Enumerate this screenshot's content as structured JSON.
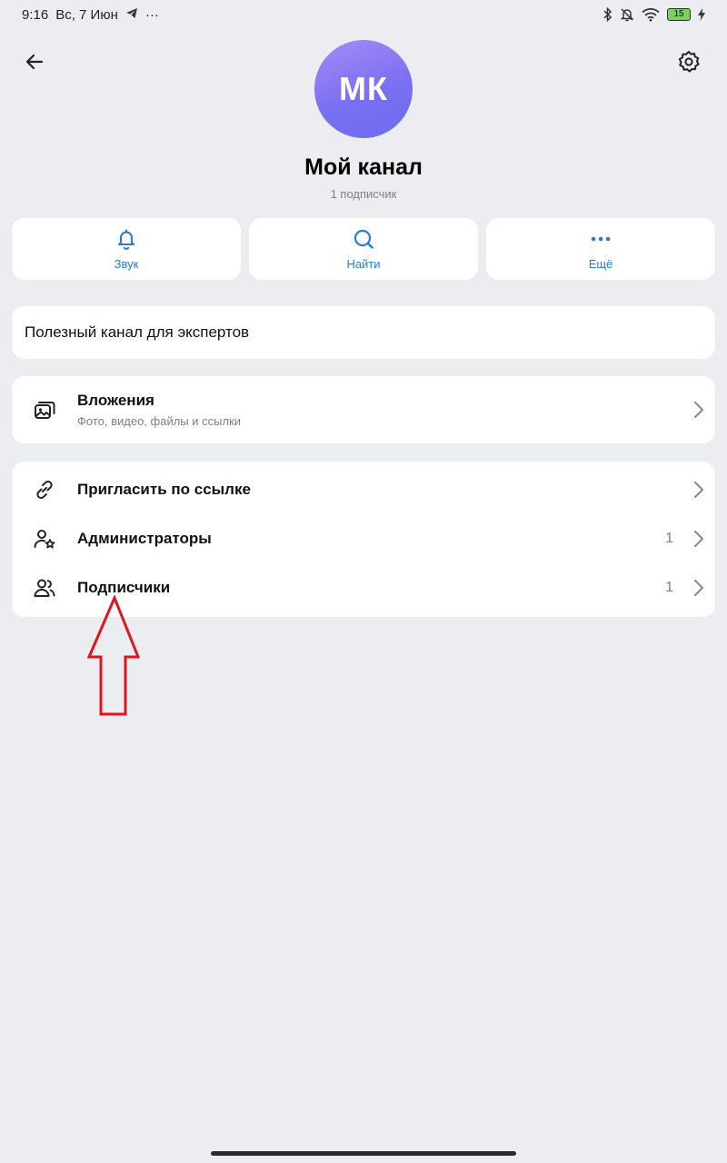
{
  "status_bar": {
    "time": "9:16",
    "date": "Вс, 7 Июн",
    "more": "···",
    "battery": "15",
    "icons": [
      "telegram-icon",
      "bluetooth-icon",
      "mute-bell-icon",
      "wifi-icon",
      "battery-icon",
      "charging-icon"
    ]
  },
  "header": {
    "back_icon": "arrow-left-icon",
    "settings_icon": "gear-icon",
    "avatar_initials": "МК",
    "title": "Мой канал",
    "subtitle": "1 подписчик"
  },
  "actions": [
    {
      "label": "Звук",
      "icon": "bell-icon"
    },
    {
      "label": "Найти",
      "icon": "search-icon"
    },
    {
      "label": "Ещё",
      "icon": "more-dots-icon"
    }
  ],
  "description": "Полезный канал для экспертов",
  "attachments": {
    "title": "Вложения",
    "subtitle": "Фото, видео, файлы и ссылки"
  },
  "links": [
    {
      "label": "Пригласить по ссылке",
      "count": "",
      "icon": "link-icon"
    },
    {
      "label": "Администраторы",
      "count": "1",
      "icon": "admin-star-icon"
    },
    {
      "label": "Подписчики",
      "count": "1",
      "icon": "users-icon"
    }
  ],
  "colors": {
    "background": "#ebedf0",
    "accent": "#2a7bd6",
    "annotation_arrow": "#e0141e",
    "avatar_gradient_start": "#a48cf7",
    "avatar_gradient_end": "#6a6ef0"
  }
}
